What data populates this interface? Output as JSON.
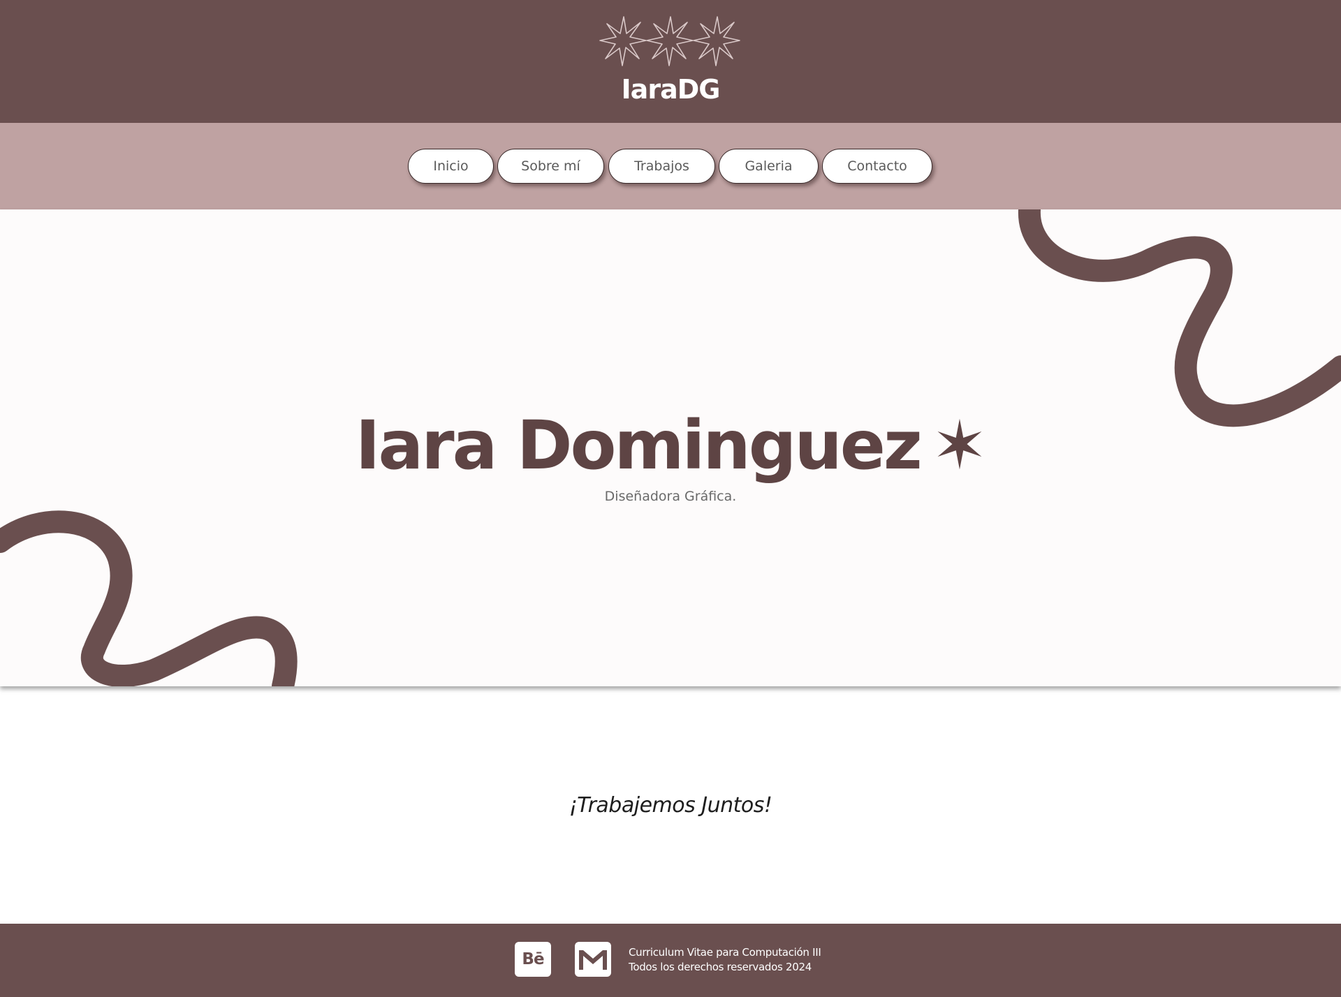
{
  "header": {
    "brand": "IaraDG",
    "logo_icon": "three-stars-outline-icon"
  },
  "nav": {
    "items": [
      {
        "label": "Inicio"
      },
      {
        "label": "Sobre mí"
      },
      {
        "label": "Trabajos"
      },
      {
        "label": "Galeria"
      },
      {
        "label": "Contacto"
      }
    ]
  },
  "hero": {
    "title": "Iara Dominguez",
    "title_icon": "six-point-star-icon",
    "subtitle": "Diseñadora Gráfica."
  },
  "cta": {
    "text": "¡Trabajemos Juntos!"
  },
  "footer": {
    "behance_icon_text": "Bē",
    "mail_icon": "mail-icon",
    "line1": "Curriculum Vitae para Computación III",
    "line2": "Todos los derechos reservados 2024"
  },
  "colors": {
    "primary": "#6a4f4f",
    "secondary": "#bfa2a2",
    "accent_dark": "#5e4444",
    "hero_bg": "#fdfbfb"
  }
}
